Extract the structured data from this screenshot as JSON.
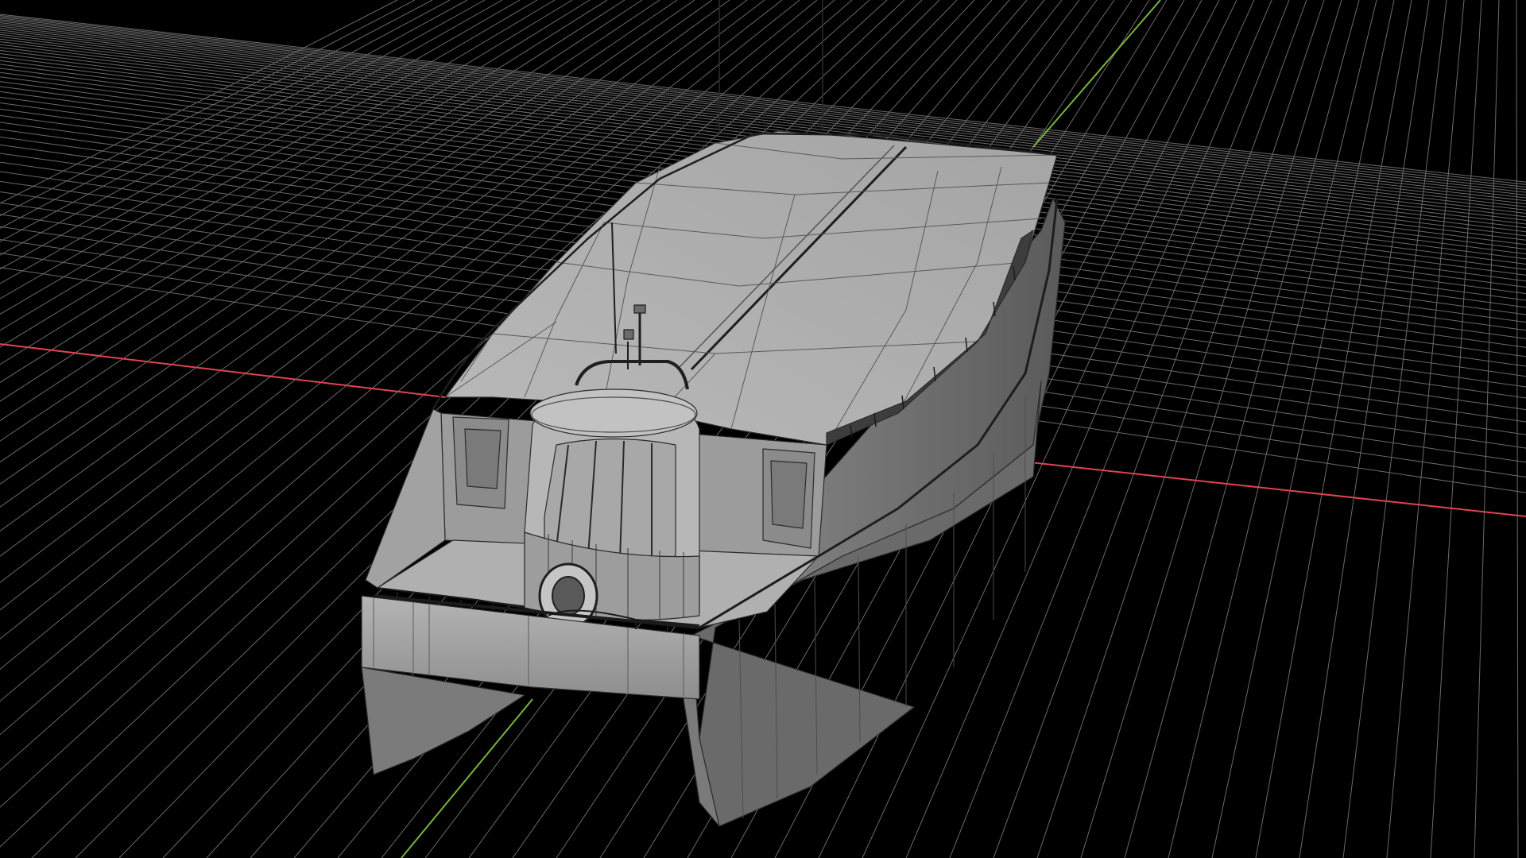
{
  "viewport": {
    "kind": "3d-viewport",
    "shading": "solid-wireframe",
    "background_color": "#000000",
    "grid_color": "#6a6a6a",
    "x_axis_color": "#e0434f",
    "y_axis_color": "#79b43c"
  },
  "model": {
    "subject": "catamaran-ferry",
    "base_color": "#a9a9a9",
    "wire_color": "#2b2b2b"
  }
}
